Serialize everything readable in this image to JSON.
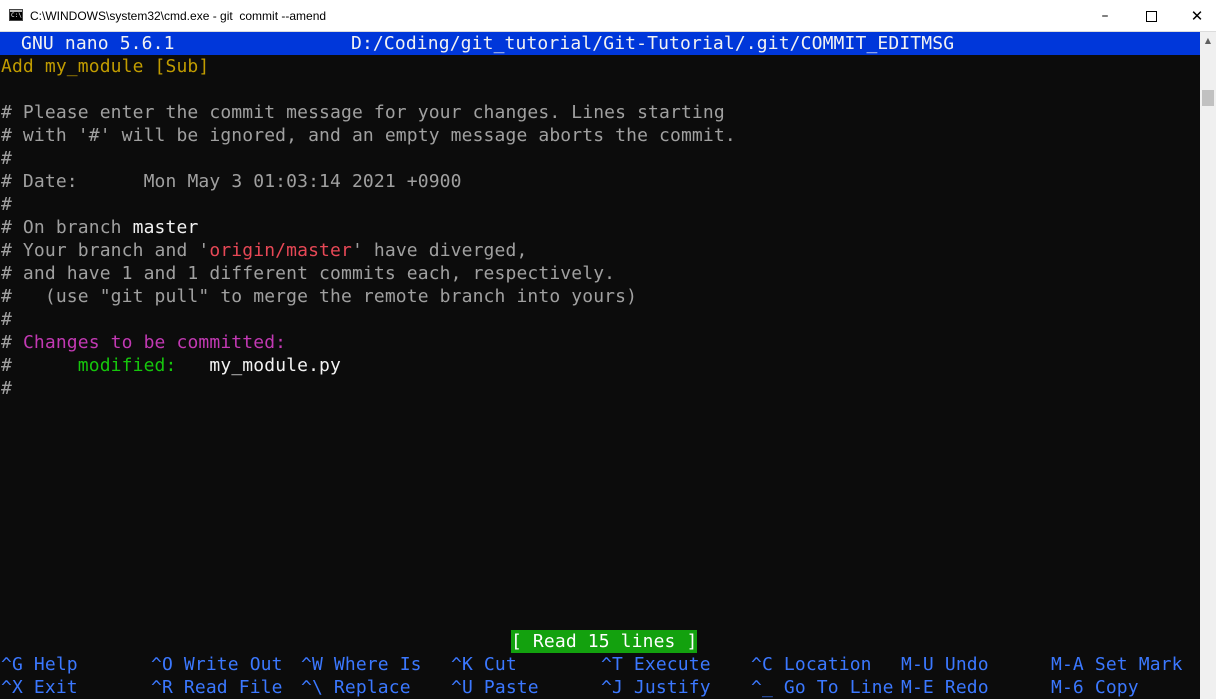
{
  "window": {
    "title": "C:\\WINDOWS\\system32\\cmd.exe - git  commit --amend",
    "minimize": "–",
    "close": "✕"
  },
  "nano": {
    "version": "GNU nano 5.6.1",
    "file_path": "D:/Coding/git_tutorial/Git-Tutorial/.git/COMMIT_EDITMSG"
  },
  "buffer": {
    "commit_message": "Add my_module [Sub]",
    "comment_1": "# Please enter the commit message for your changes. Lines starting",
    "comment_2": "# with '#' will be ignored, and an empty message aborts the commit.",
    "hash": "#",
    "date_prefix": "# Date:      ",
    "date_value": "Mon May 3 01:03:14 2021 +0900",
    "branch_prefix": "# On branch ",
    "branch_name": "master",
    "diverged_prefix": "# Your branch and '",
    "diverged_remote": "origin/master",
    "diverged_suffix": "' have diverged,",
    "commits_line": "# and have 1 and 1 different commits each, respectively.",
    "pull_hint": "#   (use \"git pull\" to merge the remote branch into yours)",
    "changes_header": "Changes to be committed:",
    "modified_label": "modified:",
    "modified_file": "my_module.py"
  },
  "status_message": "[ Read 15 lines ]",
  "shortcuts_row1": [
    {
      "key": "^G",
      "label": "Help"
    },
    {
      "key": "^O",
      "label": "Write Out"
    },
    {
      "key": "^W",
      "label": "Where Is"
    },
    {
      "key": "^K",
      "label": "Cut"
    },
    {
      "key": "^T",
      "label": "Execute"
    },
    {
      "key": "^C",
      "label": "Location"
    },
    {
      "key": "M-U",
      "label": "Undo"
    },
    {
      "key": "M-A",
      "label": "Set Mark"
    }
  ],
  "shortcuts_row2": [
    {
      "key": "^X",
      "label": "Exit"
    },
    {
      "key": "^R",
      "label": "Read File"
    },
    {
      "key": "^\\",
      "label": "Replace"
    },
    {
      "key": "^U",
      "label": "Paste"
    },
    {
      "key": "^J",
      "label": "Justify"
    },
    {
      "key": "^_",
      "label": "Go To Line"
    },
    {
      "key": "M-E",
      "label": "Redo"
    },
    {
      "key": "M-6",
      "label": "Copy"
    }
  ],
  "colors": {
    "background": "#0c0c0c",
    "header_bg": "#0037da",
    "status_bg": "#13a10e",
    "shortcut_blue": "#3b78ff",
    "branch_red": "#e74856",
    "magenta": "#c239b3",
    "green": "#16c60c",
    "yellow": "#c19c00"
  }
}
